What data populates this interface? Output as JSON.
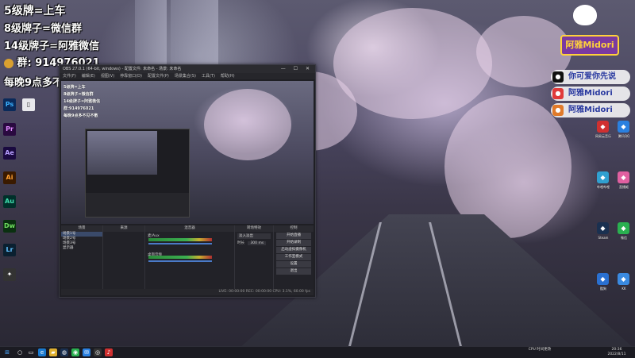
{
  "overlay_left": {
    "line1": "5级牌=上车",
    "line2": "8级牌子=微信群",
    "line3": "14级牌子=阿雅微信",
    "line4_label": "群:",
    "line4_number": "914976021",
    "line5": "每晚9点多不见不散"
  },
  "overlay_right": {
    "logo_text": "阿雅Midori",
    "buttons": [
      {
        "icon": "tiktok-icon",
        "label": "你可爱你先说",
        "color": "#111111"
      },
      {
        "icon": "weibo-icon",
        "label": "阿雅Midori",
        "color": "#e03a3a"
      },
      {
        "icon": "weibo-icon",
        "label": "阿雅Midori",
        "color": "#e07a2a"
      }
    ]
  },
  "obs": {
    "title": "OBS 27.0.1 (64-bit, windows) - 配置文件: 未命名 - 场景: 未命名",
    "menu": [
      "文件(F)",
      "编辑(E)",
      "视图(V)",
      "停靠窗口(D)",
      "配置文件(P)",
      "场景集合(S)",
      "工具(T)",
      "帮助(H)"
    ],
    "window_controls": "— ☐ ✕",
    "preview_lines": [
      "5级牌=上车",
      "8级牌子=微信群",
      "14级牌子=阿雅微信",
      "群:914976021",
      "每晚9点多不见不散"
    ],
    "docks": {
      "scenes_header": "场景",
      "sources_header": "来源",
      "mixer_header": "混音器",
      "transitions_header": "转场特效",
      "controls_header": "控制",
      "scene_items": [
        "场景1号",
        "场景2号",
        "场景3号",
        "显示器"
      ],
      "mixer_channels": [
        "麦/Aux",
        "桌面音频"
      ],
      "transition_name": "淡入淡出",
      "transition_duration_label": "时长",
      "transition_duration": "300 ms",
      "controls": [
        "开始直播",
        "开始录制",
        "启动虚拟摄像机",
        "工作室模式",
        "设置",
        "退出"
      ]
    },
    "status": "LIVE: 00:00:00   REC: 00:00:00   CPU: 3.1%, 60.00 fps"
  },
  "taskbar": {
    "time": "20:36",
    "date": "2022/8/11",
    "weather": "CPU 时间更改"
  },
  "desktop_icons_right": [
    "网易云音乐",
    "腾讯QQ",
    "哔哩哔哩",
    "直播姬",
    "Steam",
    "微信",
    "酷狗",
    "KK"
  ]
}
